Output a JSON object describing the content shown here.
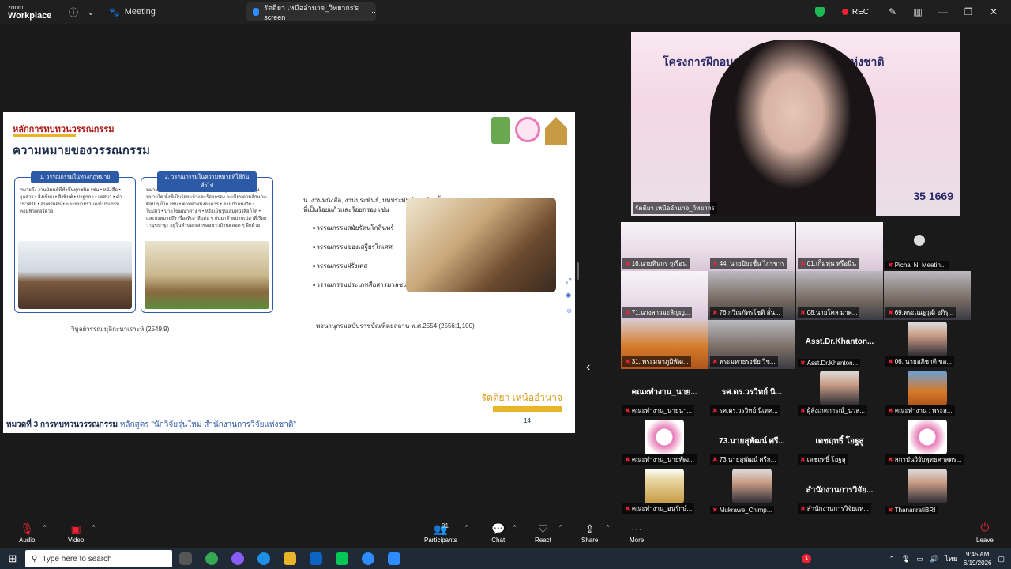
{
  "topbar": {
    "brand_top": "zoom",
    "brand_bottom": "Workplace",
    "meeting_label": "Meeting",
    "screen_tab_label": "รัตติยา เหนืออำนาจ_วิทยากร's screen",
    "rec_label": "REC"
  },
  "slide": {
    "kicker": "หลักการทบทวนวรรณกรรม",
    "title": "ความหมายของวรรณกรรม",
    "box1_title": "1. วรรณกรรมในทางกฎหมาย",
    "box1_text": "หมายถึง งานนิพนธ์ที่ทำขึ้นทุกชนิด เช่น • หนังสือ • จุลสาร • สิ่งเขียน • สิ่งพิมพ์ • ปาฐกถา • เทศนา • คำปราศรัย • สุนทรพจน์ • และหมายรวมถึงโปรแกรมคอมพิวเตอร์ด้วย",
    "box2_title": "2. วรรณกรรมในความหมายที่ใช้กันทั่วไป",
    "box2_text": "หมายถึง งานเขียนทุกชนิด ไม่ว่าจะเป็นรูปแบบใด หรือมุ่งหมายใด ทั้งที่เป็นร้อยแก้วและร้อยกรอง จะเขียนตามลักษณะศิลป ๆ ก็ได้ เช่น • ตามฝาผนังอาคาร • ตามกำแพงวัด • ใบปลิว • ป้ายโฆษณาต่าง ๆ • หรือเป็นรูปเล่มหนังสือก็ได้ • และยังหมายถึง เรื่องที่เล่าสืบต่อ ๆ กันมาด้วยปากเปล่าที่เรียกว่ามุขปาฐะ อยู่ในคำบอกเล่าของชาวบ้านตลอด ๆ อีกด้วย",
    "citation_left": "วิบูลย์วรรณ มุลิกะนาเราะห์ (2549:9)",
    "mid_heading": "น. งานหนังสือ, งานประพันธ์, บทประพันธ์ทุกชนิด ทั้งที่เป็นร้อยแก้วและร้อยกรอง เช่น",
    "mid_items": [
      "วรรณกรรมสมัยรัตนโกสินทร์",
      "วรรณกรรมของเสฐียรโกเศศ",
      "วรรณกรรมฝรั่งเศส",
      "วรรณกรรมประเภทสื่อสารมวลชน"
    ],
    "citation_right": "พจนานุกรมฉบับราชบัณฑิตยสถาน พ.ศ.2554 (2556:1,100)",
    "author": "รัตติยา เหนืออำนาจ",
    "page_number": "14",
    "footer_bold": "หมวดที่ 3 การทบทวนวรรณกรรม",
    "footer_rest": "หลักสูตร \"นักวิจัยรุ่นใหม่ สำนักงานการวิจัยแห่งชาติ\""
  },
  "speaker": {
    "banner": "โครงการฝึกอบรมนักวิจัยรุ่น... การวิจัยแห่งชาติ",
    "number_text": "35 1669",
    "name": "รัตติยา เหนืออำนาจ_วิทยากร"
  },
  "participants": [
    {
      "name": "16.นายทินกร จุเรือน",
      "style": "slide",
      "big": ""
    },
    {
      "name": "44. นายปิยะชื่น ไกรชาร",
      "style": "slide",
      "big": ""
    },
    {
      "name": "01.เก็มทุน หรือนิ่น",
      "style": "slide",
      "big": ""
    },
    {
      "name": "Pichai N. Meetin...",
      "style": "black",
      "big": ""
    },
    {
      "name": "71.นางสาวมะลิญญ...",
      "style": "slide",
      "big": ""
    },
    {
      "name": "76.กวีณภัทรโชติ สั่น...",
      "style": "person",
      "big": ""
    },
    {
      "name": "08.นายโศล มาศ...",
      "style": "person",
      "big": ""
    },
    {
      "name": "69.พระเณฐวุฒิ อภิรุ...",
      "style": "person",
      "big": ""
    },
    {
      "name": "31. พระมหาภูมิพัฒ...",
      "style": "monk",
      "big": ""
    },
    {
      "name": "พระมหาธรงชัย วิช...",
      "style": "person",
      "big": ""
    },
    {
      "name": "Asst.Dr.Khanton...",
      "style": "black",
      "big": "Asst.Dr.Khanton..."
    },
    {
      "name": "06. นายอภิชาติ ชอ...",
      "style": "black",
      "big": ""
    },
    {
      "name": "คณะทำงาน_นายนา...",
      "style": "black",
      "big": "คณะทำงาน_นาย..."
    },
    {
      "name": "รศ.ดร.วรวิทย์ นิเทศ...",
      "style": "black",
      "big": "รศ.ดร.วรวิทย์ นิ..."
    },
    {
      "name": "ผู้สังเกตการณ์_นวส...",
      "style": "black",
      "big": ""
    },
    {
      "name": "คณะทำงาน : พระส...",
      "style": "black",
      "big": ""
    },
    {
      "name": "คณะทำงาน_นายพัฒ...",
      "style": "black",
      "big": ""
    },
    {
      "name": "73.นายสุพัฒน์ ศรีก...",
      "style": "black",
      "big": "73.นายสุพัฒน์ ศรี..."
    },
    {
      "name": "เดชฤทธิ์ โอฐสู",
      "style": "black",
      "big": "เดชฤทธิ์ โอฐสู"
    },
    {
      "name": "สถาบันวิจัยพุทธศาสตร...",
      "style": "black",
      "big": ""
    },
    {
      "name": "คณะทำงาน_อนุรักษ์...",
      "style": "black",
      "big": ""
    },
    {
      "name": "Mukrawe_Chimp...",
      "style": "black",
      "big": ""
    },
    {
      "name": "สำนักงานการวิจัยแห...",
      "style": "black",
      "big": "สำนักงานการวิจัย..."
    },
    {
      "name": "ThananratiBRI",
      "style": "black",
      "big": ""
    }
  ],
  "toolbar": {
    "audio": "Audio",
    "video": "Video",
    "participants": "Participants",
    "participants_count": "91",
    "chat": "Chat",
    "react": "React",
    "share": "Share",
    "more": "More",
    "leave": "Leave"
  },
  "taskbar": {
    "search_placeholder": "Type here to search",
    "time": "9:45 AM",
    "date": "6/19/2026",
    "lang": "ไทย",
    "notif_count": "1"
  },
  "colors": {
    "zoom_blue": "#2d8cff",
    "rec_red": "#e22233",
    "slide_title": "#1b2a4a",
    "slide_kicker": "#b01818",
    "accent_gold": "#e8b52a"
  }
}
